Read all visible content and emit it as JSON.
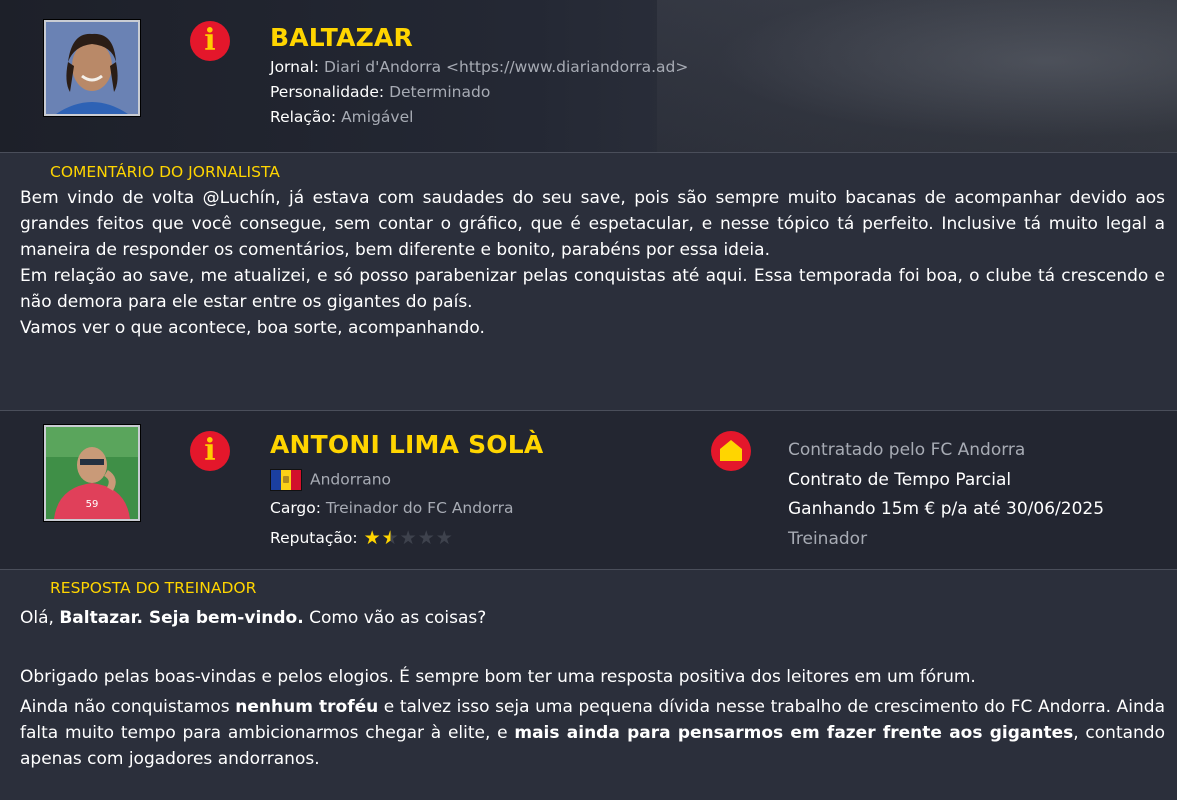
{
  "journalist": {
    "name": "BALTAZAR",
    "newspaper_label": "Jornal:",
    "newspaper_value": "Diari d'Andorra <https://www.diariandorra.ad>",
    "personality_label": "Personalidade:",
    "personality_value": "Determinado",
    "relation_label": "Relação:",
    "relation_value": "Amigável",
    "comment_title": "COMENTÁRIO DO JORNALISTA",
    "comment_p1": "Bem vindo de volta @Luchín, já estava com saudades do seu save, pois são sempre muito bacanas de acompanhar devido aos grandes feitos que você consegue, sem contar o gráfico, que é espetacular, e nesse tópico tá perfeito. Inclusive tá muito legal a maneira de responder os comentários, bem diferente e bonito, parabéns por essa ideia.",
    "comment_p2": "Em relação ao save, me atualizei, e só posso parabenizar pelas conquistas até aqui. Essa temporada foi boa, o clube tá crescendo e não demora para ele estar entre os gigantes do país.",
    "comment_p3": "Vamos ver o que acontece, boa sorte, acompanhando."
  },
  "coach": {
    "name": "ANTONI LIMA SOLÀ",
    "nationality": "Andorrano",
    "role_label": "Cargo:",
    "role_value": "Treinador do FC Andorra",
    "reputation_label": "Reputação:",
    "reputation_stars": 1.5,
    "reputation_max": 5,
    "contract_line1": "Contratado pelo FC Andorra",
    "contract_line2": "Contrato de Tempo Parcial",
    "contract_line3": "Ganhando 15m € p/a até 30/06/2025",
    "contract_line4": "Treinador",
    "reply_title": "RESPOSTA DO TREINADOR",
    "reply_l1_a": "Olá, ",
    "reply_l1_b": "Baltazar. Seja bem-vindo.",
    "reply_l1_c": " Como vão as coisas?",
    "reply_p2": "Obrigado pelas boas-vindas e pelos elogios. É sempre bom ter uma resposta positiva dos leitores em um fórum.",
    "reply_p3_a": "Ainda não conquistamos ",
    "reply_p3_b": "nenhum troféu",
    "reply_p3_c": " e talvez isso seja uma pequena dívida nesse trabalho de crescimento do FC Andorra. Ainda falta muito tempo para ambicionarmos chegar à elite, e ",
    "reply_p3_d": "mais ainda para pensarmos em fazer frente aos gigantes",
    "reply_p3_e": ", contando apenas com jogadores andorranos."
  },
  "colors": {
    "accent_yellow": "#ffd500",
    "icon_red": "#e4172b",
    "background": "#2b2f3b"
  },
  "icons": [
    "info-icon",
    "home-icon",
    "andorra-flag",
    "star-icon"
  ]
}
